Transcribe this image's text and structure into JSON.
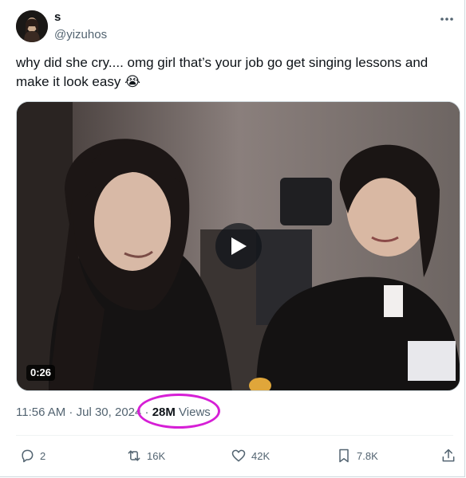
{
  "author": {
    "display_name": "s",
    "handle": "@yizuhos"
  },
  "tweet": {
    "text": "why did she cry.... omg girl that’s your job go get singing lessons and make it look easy",
    "emoji": "😭"
  },
  "media": {
    "duration": "0:26"
  },
  "meta": {
    "time": "11:56 AM",
    "separator1": " · ",
    "date": "Jul 30, 2024",
    "separator2": " · ",
    "views_count": "28M",
    "views_label": " Views"
  },
  "actions": {
    "replies": "2",
    "reposts": "16K",
    "likes": "42K",
    "bookmarks": "7.8K"
  },
  "icons": [
    "more-icon",
    "reply-icon",
    "repost-icon",
    "like-icon",
    "bookmark-icon",
    "share-icon",
    "play-icon"
  ],
  "colors": {
    "text": "#0f1419",
    "secondary": "#536471",
    "highlight": "#d61fd6",
    "border": "#cfd9de"
  }
}
